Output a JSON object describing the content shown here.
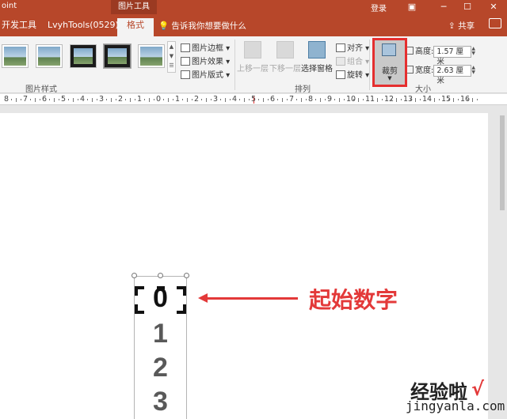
{
  "titlebar": {
    "app_name": "oint",
    "context_tab": "图片工具",
    "login": "登录",
    "restore_icon": "ribbon-display-icon",
    "min_glyph": "─",
    "max_glyph": "☐",
    "close_glyph": "✕"
  },
  "tabs": {
    "dev": "开发工具",
    "lvyh": "LvyhTools(0529)",
    "format": "格式",
    "tellme": "告诉我你想要做什么",
    "share": "共享"
  },
  "ribbon": {
    "group_styles_label": "图片样式",
    "border": "图片边框",
    "effects": "图片效果",
    "layout": "图片版式",
    "bring_forward": "上移一层",
    "send_backward": "下移一层",
    "selection_pane": "选择窗格",
    "align": "对齐",
    "group": "组合",
    "rotate": "旋转",
    "group_arrange_label": "排列",
    "crop": "裁剪",
    "height_label": "高度:",
    "height_value": "1.57 厘米",
    "width_label": "宽度:",
    "width_value": "2.63 厘米",
    "group_size_label": "大小"
  },
  "ruler": {
    "labels": [
      "8",
      "7",
      "6",
      "5",
      "4",
      "3",
      "2",
      "1",
      "0",
      "1",
      "2",
      "3",
      "4",
      "5",
      "6",
      "7",
      "8",
      "9",
      "10",
      "11",
      "12",
      "13",
      "14",
      "15",
      "16"
    ]
  },
  "slide": {
    "digits": [
      "0",
      "1",
      "2",
      "3"
    ],
    "callout": "起始数字"
  },
  "watermark": {
    "line1": "经验啦",
    "check": "√",
    "line2": "jingyanla.com"
  },
  "colors": {
    "accent": "#b7472a",
    "highlight": "#e52e2e",
    "callout": "#e33939"
  }
}
